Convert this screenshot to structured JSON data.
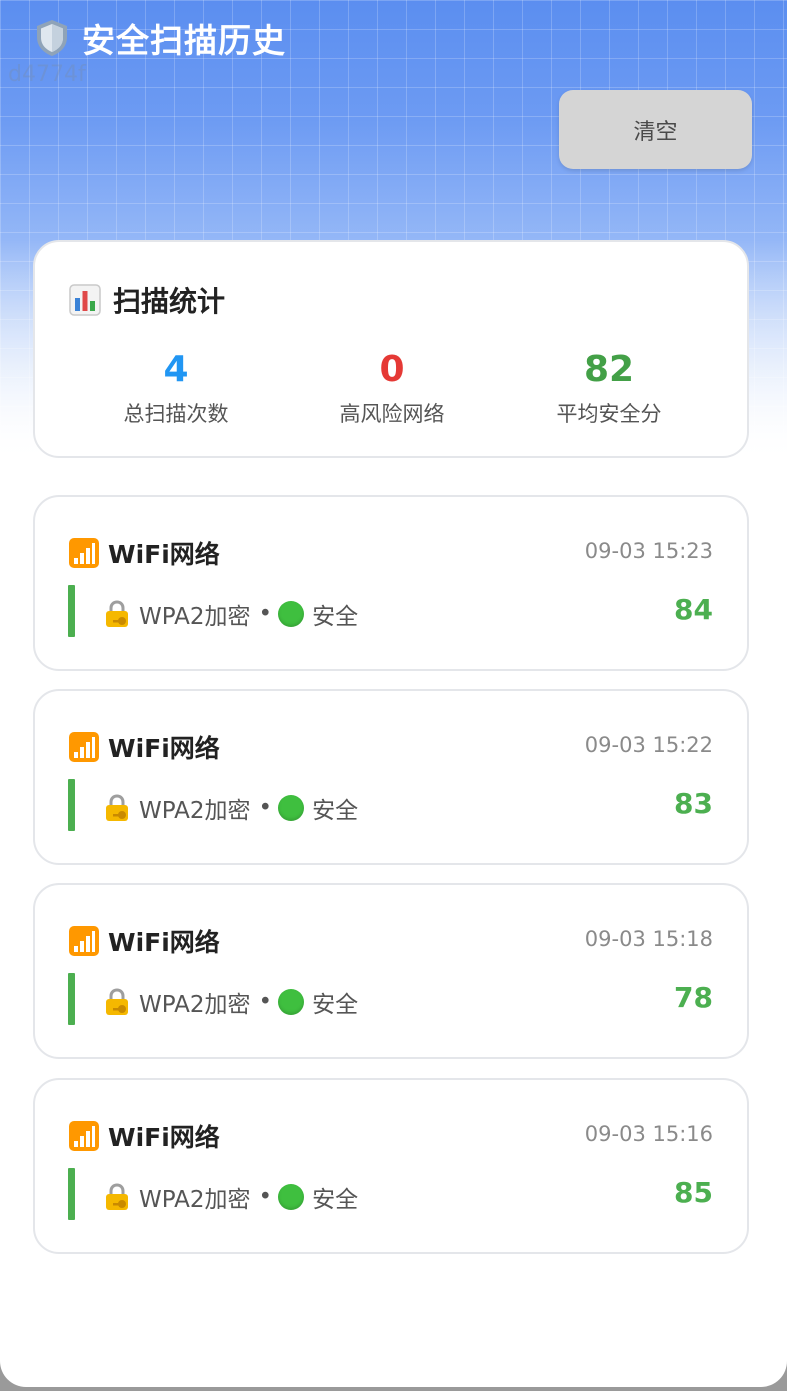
{
  "header": {
    "title": "安全扫描历史",
    "watermark": "d4774f",
    "clear_label": "清空"
  },
  "stats": {
    "title": "扫描统计",
    "items": [
      {
        "value": "4",
        "label": "总扫描次数",
        "color": "#2196f3"
      },
      {
        "value": "0",
        "label": "高风险网络",
        "color": "#e53935"
      },
      {
        "value": "82",
        "label": "平均安全分",
        "color": "#43a047"
      }
    ]
  },
  "records": [
    {
      "title": "WiFi网络",
      "time": "09-03 15:23",
      "encryption": "WPA2加密",
      "separator": "•",
      "status": "安全",
      "score": "84"
    },
    {
      "title": "WiFi网络",
      "time": "09-03 15:22",
      "encryption": "WPA2加密",
      "separator": "•",
      "status": "安全",
      "score": "83"
    },
    {
      "title": "WiFi网络",
      "time": "09-03 15:18",
      "encryption": "WPA2加密",
      "separator": "•",
      "status": "安全",
      "score": "78"
    },
    {
      "title": "WiFi网络",
      "time": "09-03 15:16",
      "encryption": "WPA2加密",
      "separator": "•",
      "status": "安全",
      "score": "85"
    }
  ],
  "colors": {
    "accent_green": "#4caf50",
    "status_safe_dot": "#3fbf3f",
    "clear_button_bg": "#d5d5d5"
  }
}
